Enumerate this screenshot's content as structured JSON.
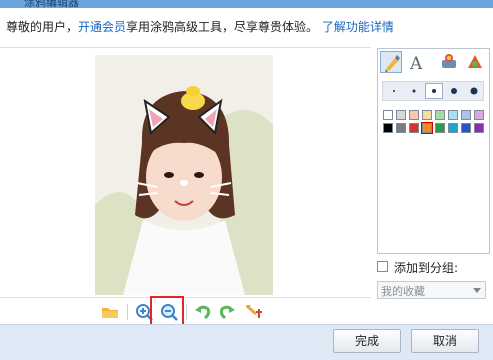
{
  "window": {
    "title": "涂鸦编辑器"
  },
  "notice": {
    "part1": "尊敬的用户，",
    "link1": "开通会员",
    "part2": "享用涂鸦高级工具，尽享尊贵体验。",
    "link2": "了解功能详情"
  },
  "tools": [
    "brush-icon",
    "text-icon",
    "stamp-icon",
    "shapes-icon"
  ],
  "brush_sizes": {
    "count": 5,
    "selected_index": 2
  },
  "palette": {
    "selected_index": 11,
    "colors": [
      "#ffffff",
      "#d7d7d7",
      "#f7c8b3",
      "#f4dda0",
      "#a5dba3",
      "#a8e0ee",
      "#a9c3ec",
      "#d7a9e0",
      "#000000",
      "#7a7a7a",
      "#d9312b",
      "#f08a24",
      "#2a9d44",
      "#1fa3d6",
      "#2c54c4",
      "#8a2fb0"
    ]
  },
  "add_group": {
    "label": "添加到分组:",
    "checked": false
  },
  "group_select": {
    "value": "我的收藏"
  },
  "bottom_tools": [
    "open-folder-icon",
    "zoom-in-icon",
    "zoom-out-icon",
    "undo-icon",
    "redo-icon",
    "crop-icon"
  ],
  "buttons": {
    "ok": "完成",
    "cancel": "取消"
  }
}
